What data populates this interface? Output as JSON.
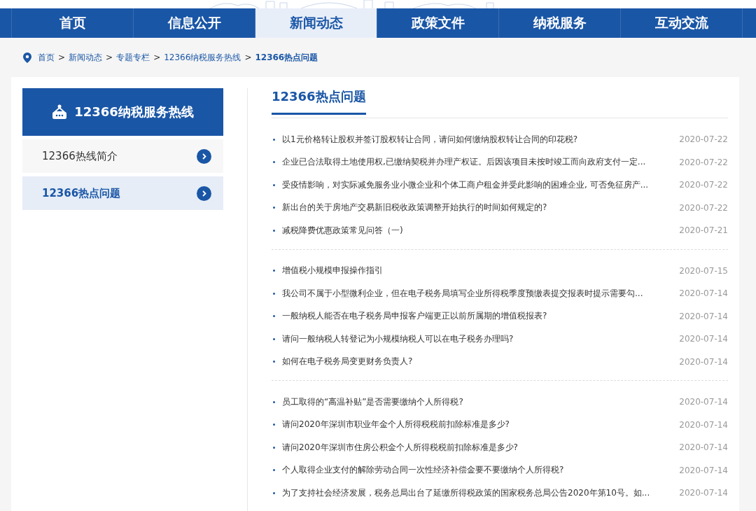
{
  "nav": {
    "tabs": [
      {
        "label": "首页",
        "selected": false
      },
      {
        "label": "信息公开",
        "selected": false
      },
      {
        "label": "新闻动态",
        "selected": true
      },
      {
        "label": "政策文件",
        "selected": false
      },
      {
        "label": "纳税服务",
        "selected": false
      },
      {
        "label": "互动交流",
        "selected": false
      }
    ]
  },
  "breadcrumb": [
    {
      "label": "首页",
      "current": false
    },
    {
      "label": "新闻动态",
      "current": false
    },
    {
      "label": "专题专栏",
      "current": false
    },
    {
      "label": "12366纳税服务热线",
      "current": false
    },
    {
      "label": "12366热点问题",
      "current": true
    }
  ],
  "breadcrumb_separator": ">",
  "sidebar": {
    "title": "12366纳税服务热线",
    "items": [
      {
        "label": "12366热线简介",
        "selected": false
      },
      {
        "label": "12366热点问题",
        "selected": true
      }
    ]
  },
  "content": {
    "title": "12366热点问题",
    "groups": [
      [
        {
          "title": "以1元价格转让股权并签订股权转让合同，请问如何缴纳股权转让合同的印花税?",
          "date": "2020-07-22"
        },
        {
          "title": "企业已合法取得土地使用权,已缴纳契税并办理产权证。后因该项目未按时竣工而向政府支付一定...",
          "date": "2020-07-22"
        },
        {
          "title": "受疫情影响，对实际减免服务业小微企业和个体工商户租金并受此影响的困难企业, 可否免征房产...",
          "date": "2020-07-22"
        },
        {
          "title": "新出台的关于房地产交易新旧税收政策调整开始执行的时间如何规定的?",
          "date": "2020-07-22"
        },
        {
          "title": "减税降费优惠政策常见问答（一)",
          "date": "2020-07-21"
        }
      ],
      [
        {
          "title": "增值税小规模申报操作指引",
          "date": "2020-07-15"
        },
        {
          "title": "我公司不属于小型微利企业，但在电子税务局填写企业所得税季度预缴表提交报表时提示需要勾...",
          "date": "2020-07-14"
        },
        {
          "title": "一般纳税人能否在电子税务局申报客户端更正以前所属期的增值税报表?",
          "date": "2020-07-14"
        },
        {
          "title": "请问一般纳税人转登记为小规模纳税人可以在电子税务办理吗?",
          "date": "2020-07-14"
        },
        {
          "title": "如何在电子税务局变更财务负责人?",
          "date": "2020-07-14"
        }
      ],
      [
        {
          "title": "员工取得的“高温补贴”是否需要缴纳个人所得税?",
          "date": "2020-07-14"
        },
        {
          "title": "请问2020年深圳市职业年金个人所得税税前扣除标准是多少?",
          "date": "2020-07-14"
        },
        {
          "title": "请问2020年深圳市住房公积金个人所得税税前扣除标准是多少?",
          "date": "2020-07-14"
        },
        {
          "title": "个人取得企业支付的解除劳动合同一次性经济补偿金要不要缴纳个人所得税?",
          "date": "2020-07-14"
        },
        {
          "title": "为了支持社会经济发展，税务总局出台了延缴所得税政策的国家税务总局公告2020年第10号。如...",
          "date": "2020-07-14"
        }
      ]
    ]
  }
}
